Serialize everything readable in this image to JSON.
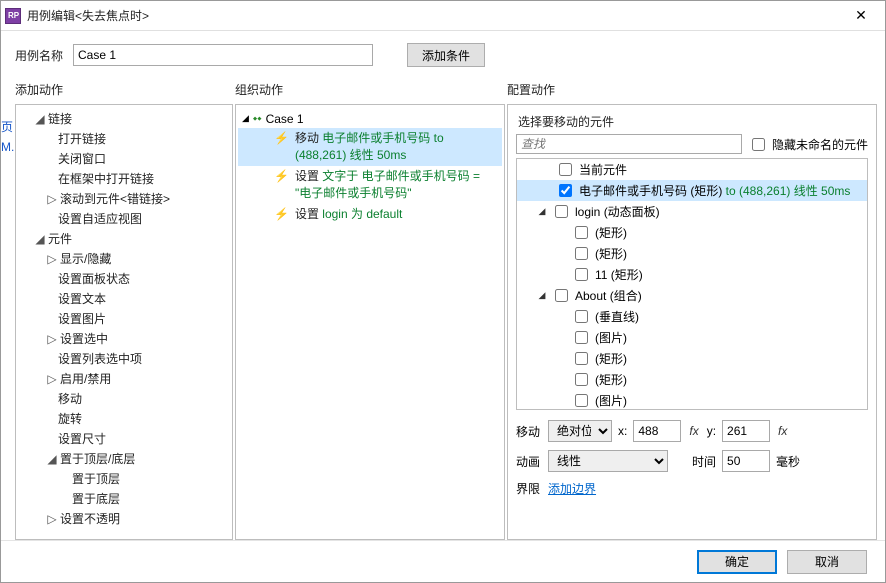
{
  "window": {
    "title": "用例编辑<失去焦点时>"
  },
  "top": {
    "name_label": "用例名称",
    "name_value": "Case 1",
    "add_condition": "添加条件"
  },
  "columns": {
    "add_action": "添加动作",
    "organize_action": "组织动作",
    "configure_action": "配置动作"
  },
  "action_tree": {
    "links": {
      "label": "链接",
      "items": [
        "打开链接",
        "关闭窗口",
        "在框架中打开链接",
        "滚动到元件<错链接>",
        "设置自适应视图"
      ]
    },
    "widgets": {
      "label": "元件",
      "items": [
        "显示/隐藏",
        "设置面板状态",
        "设置文本",
        "设置图片",
        "设置选中",
        "设置列表选中项",
        "启用/禁用",
        "移动",
        "旋转",
        "设置尺寸"
      ],
      "layer_group": {
        "label": "置于顶层/底层",
        "items": [
          "置于顶层",
          "置于底层"
        ]
      },
      "last": "设置不透明"
    },
    "indicators": {
      "expanded": "◢",
      "collapsed": "▷"
    }
  },
  "case": {
    "label": "Case 1",
    "actions": [
      {
        "verb": "移动",
        "green": "电子邮件或手机号码 to (488,261) 线性 50ms"
      },
      {
        "verb": "设置",
        "green": "文字于 电子邮件或手机号码 = \"电子邮件或手机号码\""
      },
      {
        "verb": "设置",
        "green": "login 为 default"
      }
    ]
  },
  "right": {
    "pick_label": "选择要移动的元件",
    "search_placeholder": "查找",
    "hide_unnamed": "隐藏未命名的元件",
    "items": [
      {
        "level": 2,
        "chk": false,
        "label": "当前元件"
      },
      {
        "level": 2,
        "chk": true,
        "label": "电子邮件或手机号码 (矩形)",
        "suffix": "to (488,261) 线性 50ms",
        "selected": true
      },
      {
        "level": 1,
        "exp": "◢",
        "chk": false,
        "label": "login (动态面板)"
      },
      {
        "level": 3,
        "chk": false,
        "label": "(矩形)"
      },
      {
        "level": 3,
        "chk": false,
        "label": "(矩形)"
      },
      {
        "level": 3,
        "chk": false,
        "label": "11 (矩形)"
      },
      {
        "level": 1,
        "exp": "◢",
        "chk": false,
        "label": "About (组合)"
      },
      {
        "level": 3,
        "chk": false,
        "label": "(垂直线)"
      },
      {
        "level": 3,
        "chk": false,
        "label": "(图片)"
      },
      {
        "level": 3,
        "chk": false,
        "label": "(矩形)"
      },
      {
        "level": 3,
        "chk": false,
        "label": "(矩形)"
      },
      {
        "level": 3,
        "chk": false,
        "label": "(图片)"
      }
    ],
    "move_label": "移动",
    "move_mode": "绝对位置",
    "x_label": "x:",
    "x_value": "488",
    "y_label": "y:",
    "y_value": "261",
    "anim_label": "动画",
    "anim_mode": "线性",
    "time_label": "时间",
    "time_value": "50",
    "time_unit": "毫秒",
    "bounds_label": "界限",
    "bounds_link": "添加边界"
  },
  "footer": {
    "ok": "确定",
    "cancel": "取消"
  },
  "leftedge": "页M."
}
